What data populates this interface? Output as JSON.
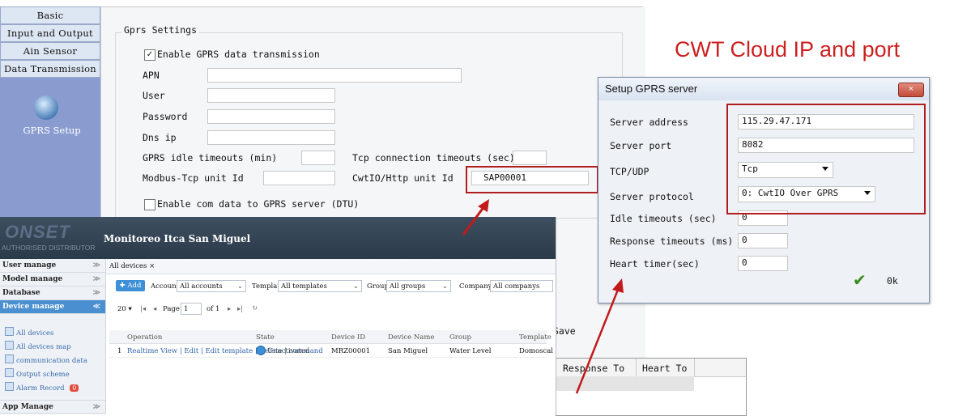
{
  "annotation": {
    "title": "CWT Cloud IP and port"
  },
  "left_tabs": [
    {
      "label": "Basic"
    },
    {
      "label": "Input and Output"
    },
    {
      "label": "Ain Sensor"
    },
    {
      "label": "Data Transmission"
    }
  ],
  "gprs_tab": {
    "label": "GPRS Setup",
    "icon": "gear-icon"
  },
  "gprs_settings": {
    "group_title": "Gprs Settings",
    "enable_gprs": {
      "label": "Enable GPRS data transmission",
      "checked": true
    },
    "apn_label": "APN",
    "user_label": "User",
    "password_label": "Password",
    "dns_label": "Dns ip",
    "idle_timeout_label": "GPRS idle timeouts (min)",
    "tcp_timeout_label": "Tcp connection timeouts (sec)",
    "modbus_unit_label": "Modbus-Tcp unit Id",
    "cwtio_unit_label": "CwtIO/Http unit Id",
    "cwtio_unit_value": "SAP00001",
    "enable_com": {
      "label": "Enable com data to GPRS server (DTU)",
      "checked": false
    },
    "save_label": "Save"
  },
  "dialog": {
    "title": "Setup GPRS server",
    "close_label": "×",
    "server_address_label": "Server address",
    "server_address_value": "115.29.47.171",
    "server_port_label": "Server port",
    "server_port_value": "8082",
    "tcp_udp_label": "TCP/UDP",
    "tcp_udp_value": "Tcp",
    "server_protocol_label": "Server protocol",
    "server_protocol_value": "0: CwtIO Over GPRS",
    "idle_timeout_label": "Idle timeouts (sec)",
    "idle_timeout_value": "0",
    "response_timeout_label": "Response timeouts (ms)",
    "response_timeout_value": "0",
    "heart_timer_label": "Heart timer(sec)",
    "heart_timer_value": "0",
    "ok_label": "0k"
  },
  "lower_table": {
    "columns": [
      "Response To",
      "Heart To"
    ]
  },
  "web": {
    "logo": "ONSET",
    "logo_sub": "AUTHORISED DISTRIBUTOR",
    "title": "Monitoreo Itca San Miguel",
    "sidebar": [
      {
        "label": "User manage"
      },
      {
        "label": "Model manage"
      },
      {
        "label": "Database"
      },
      {
        "label": "Device manage"
      }
    ],
    "sidebar_sub": [
      {
        "label": "All devices"
      },
      {
        "label": "All devices map"
      },
      {
        "label": "communication data"
      },
      {
        "label": "Output scheme"
      },
      {
        "label": "Alarm Record",
        "badge": "0"
      }
    ],
    "sidebar_bottom": "App Manage",
    "tab": "All devices",
    "add_label": "Add",
    "filters": {
      "account_label": "Account:",
      "account_value": "All accounts",
      "template_label": "Template:",
      "template_value": "All templates",
      "group_label": "Group:",
      "group_value": "All groups",
      "company_label": "Company:",
      "company_value": "All companys"
    },
    "pager": {
      "page_size": "20",
      "page_label": "Page",
      "page_value": "1",
      "of_label": "of 1"
    },
    "grid_columns": [
      "Operation",
      "State",
      "Device ID",
      "Device Name",
      "Group",
      "Template"
    ],
    "grid_rows": [
      {
        "num": "1",
        "operation": "Realtime View | Edit | Edit template | Delete | command",
        "state": "Unactivated",
        "device_id": "MRZ00001",
        "device_name": "San Miguel",
        "group": "Water Level",
        "template": "Domoscal"
      }
    ]
  }
}
